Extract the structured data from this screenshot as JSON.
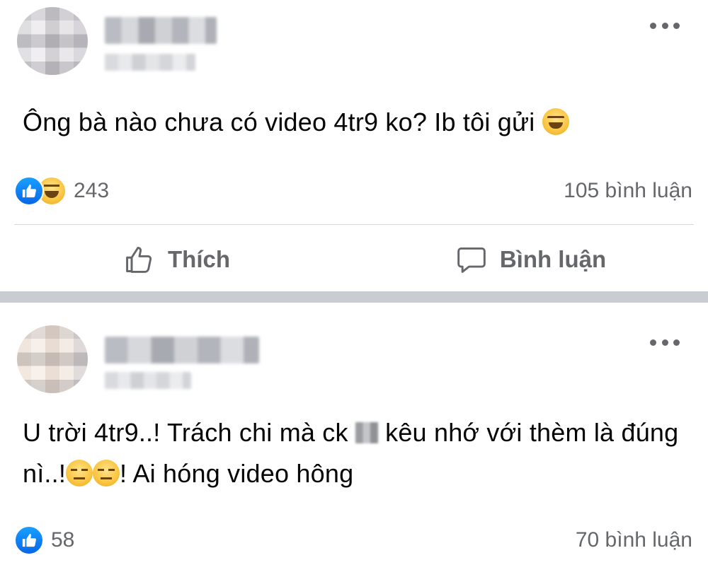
{
  "posts": [
    {
      "text_parts": [
        "Ông bà nào chưa có video 4tr9 ko? Ib tôi gửi "
      ],
      "reaction_count": "243",
      "comment_count": "105 bình luận",
      "actions": {
        "like": "Thích",
        "comment": "Bình luận"
      }
    },
    {
      "text_parts": [
        "U trời 4tr9..! Trách chi mà ck ",
        " kêu nhớ với thèm là đúng nì..!",
        "! Ai hóng video hông"
      ],
      "reaction_count": "58",
      "comment_count": "70 bình luận"
    }
  ],
  "icons": {
    "more": "more-horizontal-icon",
    "like_reaction": "like-reaction-icon",
    "haha_reaction": "haha-reaction-icon",
    "laughing_emoji": "laughing-emoji-icon",
    "expressionless_emoji": "expressionless-emoji-icon",
    "like_button": "thumbs-up-outline-icon",
    "comment_button": "speech-bubble-outline-icon"
  },
  "colors": {
    "text_primary": "#050505",
    "text_secondary": "#65676b",
    "like_blue": "#0866e8",
    "separator": "#c9ccd1"
  }
}
